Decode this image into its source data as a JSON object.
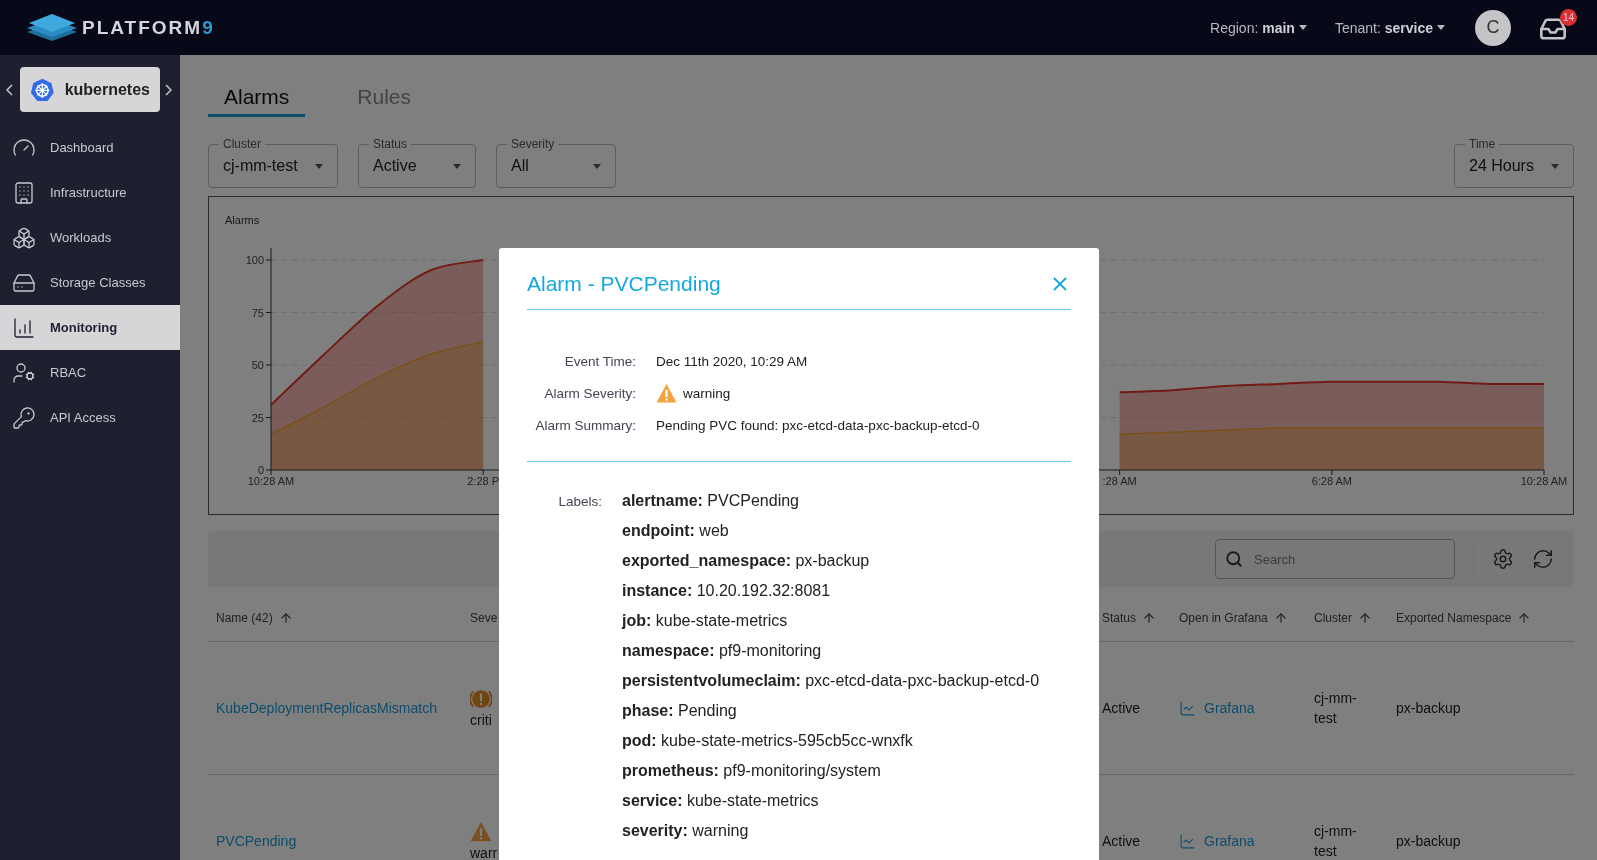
{
  "topbar": {
    "brand": {
      "name": "PLATFORM",
      "accent": "9"
    },
    "region": "Region: **main**",
    "tenant": "Tenant: **service**",
    "avatar": "C",
    "notifications": "14"
  },
  "sidebar": {
    "product": "kubernetes",
    "items": [
      {
        "label": "Dashboard",
        "selected": false
      },
      {
        "label": "Infrastructure",
        "selected": false
      },
      {
        "label": "Workloads",
        "selected": false
      },
      {
        "label": "Storage Classes",
        "selected": false
      },
      {
        "label": "Monitoring",
        "selected": true
      },
      {
        "label": "RBAC",
        "selected": false
      },
      {
        "label": "API Access",
        "selected": false
      }
    ]
  },
  "tabs": [
    {
      "label": "Alarms",
      "selected": true
    },
    {
      "label": "Rules",
      "selected": false
    }
  ],
  "filters": [
    {
      "label": "Cluster",
      "value": "cj-mm-test"
    },
    {
      "label": "Status",
      "value": "Active"
    },
    {
      "label": "Severity",
      "value": "All"
    }
  ],
  "time_filter": {
    "label": "Time",
    "value": "24 Hours"
  },
  "chart": {
    "chart_data": {
      "type": "area",
      "title": "Alarms",
      "categories": [
        "10:28 AM",
        null,
        null,
        null,
        "2:28 P",
        null,
        null,
        null,
        null,
        null,
        null,
        null,
        null,
        null,
        null,
        null,
        ":28 AM",
        null,
        null,
        null,
        "6:28 AM",
        null,
        null,
        null,
        "10:28 AM"
      ],
      "ylim": [
        0,
        100
      ],
      "yticks": [
        0,
        25,
        50,
        75,
        100
      ],
      "grid": true,
      "series": [
        {
          "color": "#e0392b",
          "values": [
            31,
            55,
            78,
            95,
            100,
            null,
            null,
            null,
            null,
            null,
            null,
            null,
            null,
            null,
            null,
            null,
            37,
            38,
            40,
            41,
            42,
            42,
            42,
            41,
            41
          ]
        },
        {
          "color": "#f0a030",
          "values": [
            17,
            30,
            44,
            55,
            61,
            null,
            null,
            null,
            null,
            null,
            null,
            null,
            null,
            null,
            null,
            null,
            17,
            18,
            19,
            20,
            20,
            20,
            20,
            20,
            20
          ]
        }
      ]
    }
  },
  "table": {
    "search": {
      "placeholder": "Search"
    },
    "columns": [
      {
        "label": "Name (42)",
        "sortable": true
      },
      {
        "label": "Seve",
        "sortable": false
      },
      {
        "label": "Status",
        "sortable": true
      },
      {
        "label": "Open in Grafana",
        "sortable": true
      },
      {
        "label": "Cluster",
        "sortable": true
      },
      {
        "label": "Exported Namespace",
        "sortable": true
      }
    ],
    "rows": [
      {
        "name": "KubeDeploymentReplicasMismatch",
        "severity": {
          "kind": "critical",
          "text": "criti"
        },
        "status": "Active",
        "grafana": "Grafana",
        "cluster": "cj-mm-test",
        "namespace": "px-backup"
      },
      {
        "name": "PVCPending",
        "severity": {
          "kind": "warning",
          "text": "warr"
        },
        "status": "Active",
        "grafana": "Grafana",
        "cluster": "cj-mm-test",
        "namespace": "px-backup"
      }
    ]
  },
  "dialog": {
    "title": "Alarm - PVCPending",
    "details": [
      {
        "label": "Event Time:",
        "value": "Dec 11th 2020, 10:29 AM"
      },
      {
        "label": "Alarm Severity:",
        "value": "warning",
        "kind": "warning"
      },
      {
        "label": "Alarm Summary:",
        "value": "Pending PVC found: pxc-etcd-data-pxc-backup-etcd-0"
      }
    ],
    "labels_heading": "Labels:",
    "labels": [
      "**alertname:** PVCPending",
      "**endpoint:** web",
      "**exported_namespace:** px-backup",
      "**instance:** 10.20.192.32:8081",
      "**job:** kube-state-metrics",
      "**namespace:** pf9-monitoring",
      "**persistentvolumeclaim:** pxc-etcd-data-pxc-backup-etcd-0",
      "**phase:** Pending",
      "**pod:** kube-state-metrics-595cb5cc-wnxfk",
      "**prometheus:** pf9-monitoring/system",
      "**service:** kube-state-metrics",
      "**severity:** warning"
    ]
  }
}
